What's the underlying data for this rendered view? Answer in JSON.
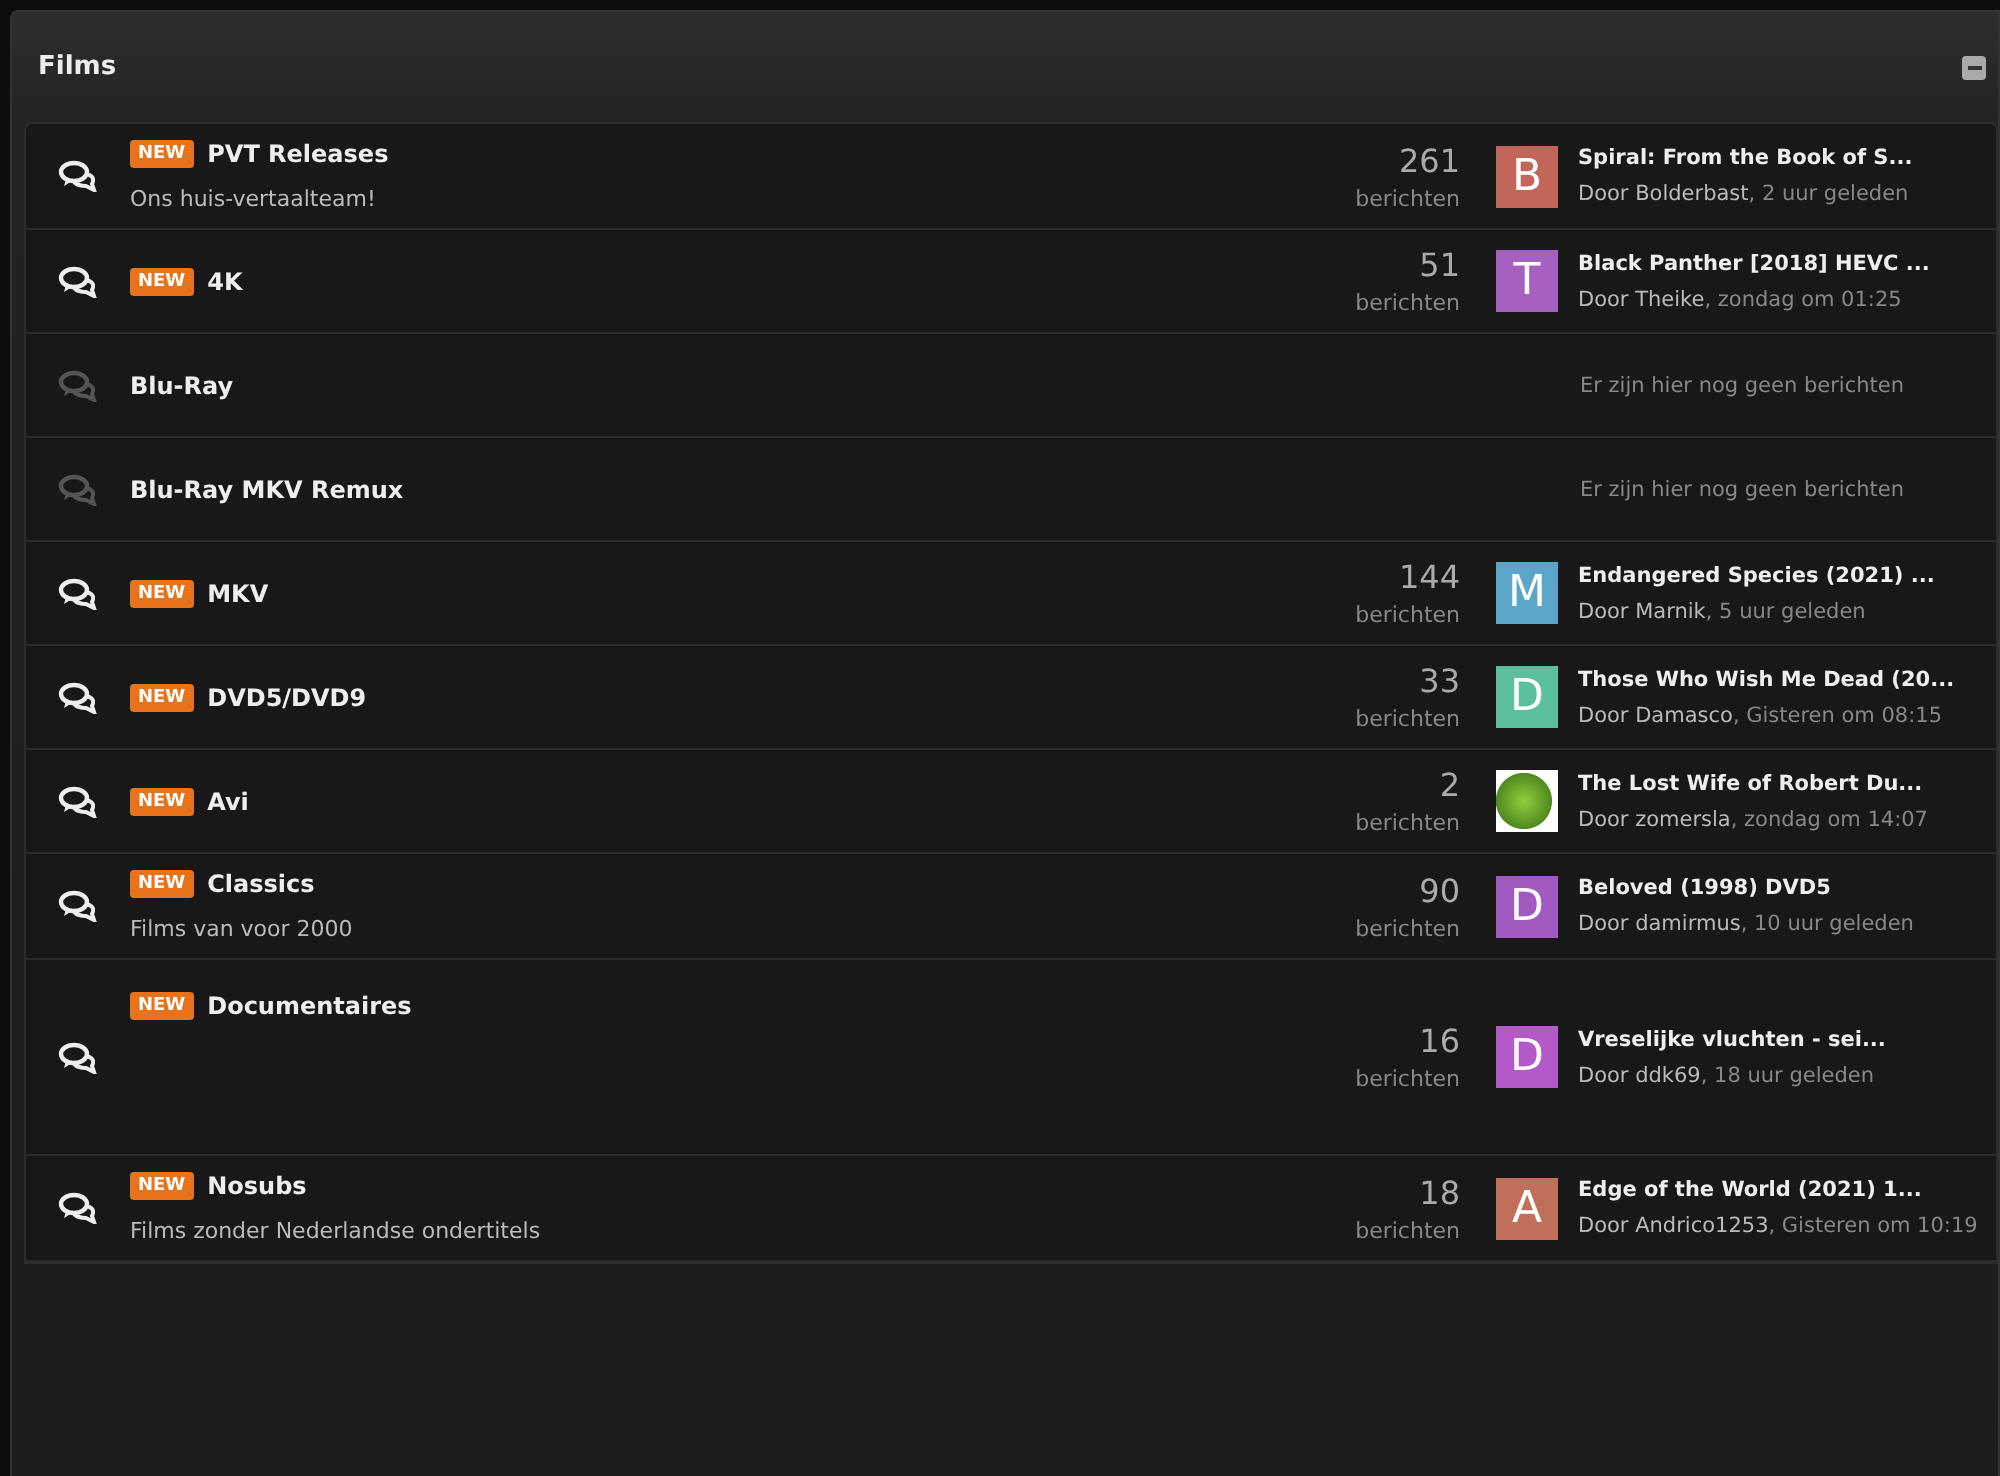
{
  "panel": {
    "title": "Films"
  },
  "forums": [
    {
      "unread": true,
      "badge": "NEW",
      "title": "PVT Releases",
      "description": "Ons huis-vertaalteam!",
      "count": "261",
      "count_label": "berichten",
      "last": {
        "avatar": {
          "kind": "letter",
          "letter": "B",
          "color": "#c2665a"
        },
        "title": "Spiral: From the Book of S...",
        "author": "Door Bolderbast",
        "time": ", 2 uur geleden"
      }
    },
    {
      "unread": true,
      "badge": "NEW",
      "title": "4K",
      "count": "51",
      "count_label": "berichten",
      "last": {
        "avatar": {
          "kind": "letter",
          "letter": "T",
          "color": "#a560c0"
        },
        "title": "Black Panther [2018] HEVC ...",
        "author": "Door Theike",
        "time": ", zondag om 01:25"
      }
    },
    {
      "unread": false,
      "title": "Blu-Ray",
      "empty": "Er zijn hier nog geen berichten"
    },
    {
      "unread": false,
      "title": "Blu-Ray MKV Remux",
      "empty": "Er zijn hier nog geen berichten"
    },
    {
      "unread": true,
      "badge": "NEW",
      "title": "MKV",
      "count": "144",
      "count_label": "berichten",
      "last": {
        "avatar": {
          "kind": "letter",
          "letter": "M",
          "color": "#5aa5c8"
        },
        "title": "Endangered Species (2021) ...",
        "author": "Door Marnik",
        "time": ", 5 uur geleden"
      }
    },
    {
      "unread": true,
      "badge": "NEW",
      "title": "DVD5/DVD9",
      "count": "33",
      "count_label": "berichten",
      "last": {
        "avatar": {
          "kind": "letter",
          "letter": "D",
          "color": "#5cbf9e"
        },
        "title": "Those Who Wish Me Dead (20...",
        "author": "Door Damasco",
        "time": ", Gisteren om 08:15"
      }
    },
    {
      "unread": true,
      "badge": "NEW",
      "title": "Avi",
      "count": "2",
      "count_label": "berichten",
      "last": {
        "avatar": {
          "kind": "photo"
        },
        "title": "The Lost Wife of Robert Du...",
        "author": "Door zomersla",
        "time": ", zondag om 14:07"
      }
    },
    {
      "unread": true,
      "badge": "NEW",
      "title": "Classics",
      "description": "Films van voor 2000",
      "count": "90",
      "count_label": "berichten",
      "last": {
        "avatar": {
          "kind": "letter",
          "letter": "D",
          "color": "#a05ac0"
        },
        "title": "Beloved (1998) DVD5",
        "author": "Door damirmus",
        "time": ", 10 uur geleden"
      }
    },
    {
      "unread": true,
      "badge": "NEW",
      "title": "Documentaires",
      "count": "16",
      "count_label": "berichten",
      "last": {
        "avatar": {
          "kind": "letter",
          "letter": "D",
          "color": "#b45ac8"
        },
        "title": "Vreselijke vluchten - sei...",
        "author": "Door ddk69",
        "time": ", 18 uur geleden"
      }
    },
    {
      "unread": true,
      "badge": "NEW",
      "title": "Nosubs",
      "description": "Films zonder Nederlandse ondertitels",
      "count": "18",
      "count_label": "berichten",
      "last": {
        "avatar": {
          "kind": "letter",
          "letter": "A",
          "color": "#c0705a"
        },
        "title": "Edge of the World (2021) 1...",
        "author": "Door Andrico1253",
        "time": ", Gisteren om 10:19"
      }
    }
  ]
}
